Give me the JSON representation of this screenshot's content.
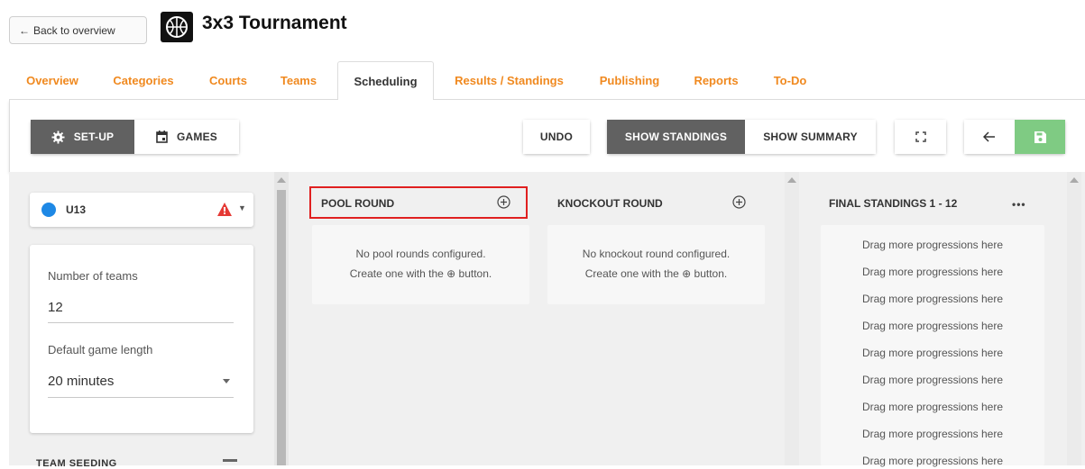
{
  "header": {
    "back_label": "Back to overview",
    "title": "3x3 Tournament",
    "logo_icon": "basketball-logo-icon"
  },
  "tabs": [
    {
      "label": "Overview",
      "active": false
    },
    {
      "label": "Categories",
      "active": false
    },
    {
      "label": "Courts",
      "active": false
    },
    {
      "label": "Teams",
      "active": false
    },
    {
      "label": "Scheduling",
      "active": true
    },
    {
      "label": "Results / Standings",
      "active": false
    },
    {
      "label": "Publishing",
      "active": false
    },
    {
      "label": "Reports",
      "active": false
    },
    {
      "label": "To-Do",
      "active": false
    }
  ],
  "toolbar": {
    "setup_label": "SET-UP",
    "games_label": "GAMES",
    "undo_label": "UNDO",
    "show_standings_label": "SHOW STANDINGS",
    "show_summary_label": "SHOW SUMMARY",
    "icons": [
      "gear-icon",
      "calendar-icon",
      "fullscreen-icon",
      "arrow-left-icon",
      "save-icon"
    ]
  },
  "sidebar": {
    "category": "U13",
    "category_color": "#1e88e5",
    "warning_color": "#e53935",
    "number_of_teams_label": "Number of teams",
    "number_of_teams_value": "12",
    "game_length_label": "Default game length",
    "game_length_value": "20 minutes",
    "team_seeding_label": "TEAM SEEDING"
  },
  "pool_round": {
    "title": "POOL ROUND",
    "empty_line1": "No pool rounds configured.",
    "empty_line2": "Create one with the ⊕ button."
  },
  "knockout_round": {
    "title": "KNOCKOUT ROUND",
    "empty_line1": "No knockout round configured.",
    "empty_line2": "Create one with the ⊕ button."
  },
  "final_standings": {
    "title": "FINAL STANDINGS 1 - 12",
    "menu": "•••",
    "drag_items": [
      "Drag more progressions here",
      "Drag more progressions here",
      "Drag more progressions here",
      "Drag more progressions here",
      "Drag more progressions here",
      "Drag more progressions here",
      "Drag more progressions here",
      "Drag more progressions here",
      "Drag more progressions here"
    ]
  },
  "colors": {
    "tab_orange": "#f0891f",
    "dark_button": "#616161",
    "save_green": "#7fcb83",
    "highlight_red": "#e02020"
  }
}
